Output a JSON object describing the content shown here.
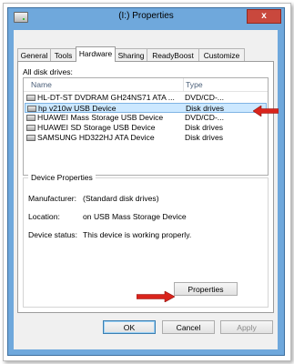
{
  "window": {
    "title": "(I:) Properties",
    "close_label": "x"
  },
  "tabs": [
    {
      "label": "General",
      "active": false
    },
    {
      "label": "Tools",
      "active": false
    },
    {
      "label": "Hardware",
      "active": true
    },
    {
      "label": "Sharing",
      "active": false
    },
    {
      "label": "ReadyBoost",
      "active": false
    },
    {
      "label": "Customize",
      "active": false
    }
  ],
  "hardware": {
    "all_disk_drives_label": "All disk drives:",
    "columns": {
      "name": "Name",
      "type": "Type"
    },
    "drives": [
      {
        "name": "HL-DT-ST DVDRAM GH24NS71 ATA ...",
        "type": "DVD/CD-...",
        "selected": false,
        "icon": "dvd-drive-icon"
      },
      {
        "name": "hp v210w USB Device",
        "type": "Disk drives",
        "selected": true,
        "icon": "disk-drive-icon"
      },
      {
        "name": "HUAWEI Mass Storage USB Device",
        "type": "DVD/CD-...",
        "selected": false,
        "icon": "dvd-drive-icon"
      },
      {
        "name": "HUAWEI SD Storage USB Device",
        "type": "Disk drives",
        "selected": false,
        "icon": "disk-drive-icon"
      },
      {
        "name": "SAMSUNG HD322HJ ATA Device",
        "type": "Disk drives",
        "selected": false,
        "icon": "disk-drive-icon"
      }
    ],
    "device_properties": {
      "title": "Device Properties",
      "manufacturer_label": "Manufacturer:",
      "manufacturer_value": "(Standard disk drives)",
      "location_label": "Location:",
      "location_value": "on USB Mass Storage Device",
      "status_label": "Device status:",
      "status_value": "This device is working properly."
    },
    "properties_button": "Properties"
  },
  "footer": {
    "ok": "OK",
    "cancel": "Cancel",
    "apply": "Apply"
  },
  "colors": {
    "selection": "#cce8ff",
    "annotation_arrow": "#d9241c",
    "window_frame": "#6fa8dc"
  }
}
